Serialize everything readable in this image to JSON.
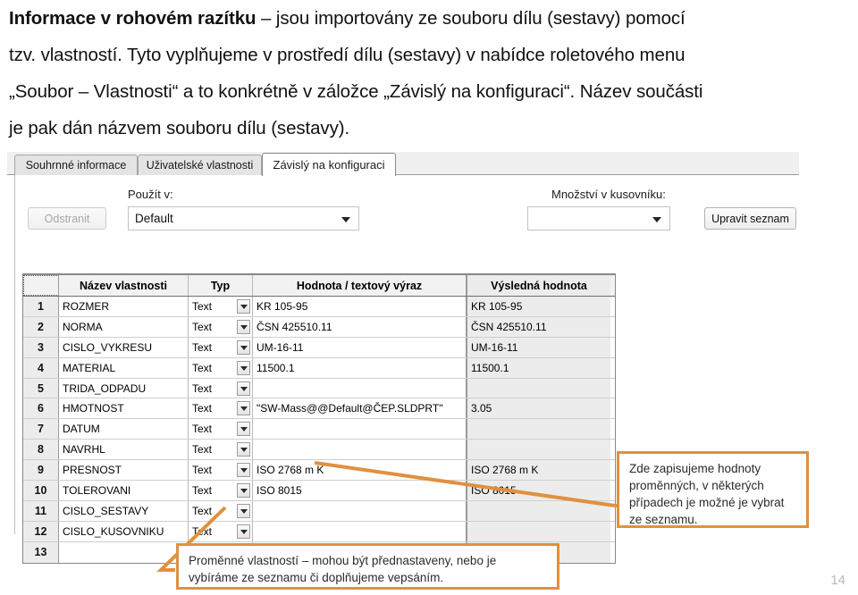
{
  "prose": {
    "lines": [
      {
        "bold": "Informace v rohovém razítku",
        "rest": " – jsou importovány ze souboru dílu (sestavy) pomocí"
      },
      {
        "bold": "",
        "rest": "tzv. vlastností. Tyto vyplňujeme v prostředí dílu (sestavy) v nabídce roletového menu"
      },
      {
        "bold": "",
        "rest": "„Soubor – Vlastnosti“ a to konkrétně v záložce „Závislý na konfiguraci“. Název součásti"
      },
      {
        "bold": "",
        "rest": "je pak dán názvem souboru dílu (sestavy)."
      }
    ]
  },
  "dialog": {
    "tabs": [
      {
        "label": "Souhrnné informace",
        "selected": false
      },
      {
        "label": "Uživatelské vlastnosti",
        "selected": false
      },
      {
        "label": "Závislý na konfiguraci",
        "selected": true
      }
    ],
    "labels": {
      "pouzit_v": "Použít v:",
      "mnozstvi": "Množství v kusovníku:"
    },
    "buttons": {
      "odstranit": "Odstranit",
      "upravit_seznam": "Upravit seznam"
    },
    "combos": {
      "pouzit_v_value": "Default",
      "pouzit_v_placeholder": "",
      "mnozstvi_value": "",
      "mnozstvi_placeholder": ""
    },
    "grid": {
      "headers": [
        "",
        "Název vlastnosti",
        "Typ",
        "Hodnota / textový výraz",
        "Výsledná hodnota"
      ],
      "rows": [
        {
          "idx": "1",
          "name": "ROZMER",
          "type": "Text",
          "value": "KR 105-95",
          "result": "KR 105-95"
        },
        {
          "idx": "2",
          "name": "NORMA",
          "type": "Text",
          "value": "ČSN 425510.11",
          "result": "ČSN 425510.11"
        },
        {
          "idx": "3",
          "name": "CISLO_VYKRESU",
          "type": "Text",
          "value": "UM-16-11",
          "result": "UM-16-11"
        },
        {
          "idx": "4",
          "name": "MATERIAL",
          "type": "Text",
          "value": "11500.1",
          "result": "11500.1"
        },
        {
          "idx": "5",
          "name": "TRIDA_ODPADU",
          "type": "Text",
          "value": "",
          "result": ""
        },
        {
          "idx": "6",
          "name": "HMOTNOST",
          "type": "Text",
          "value": "\"SW-Mass@@Default@ČEP.SLDPRT\"",
          "result": "3.05"
        },
        {
          "idx": "7",
          "name": "DATUM",
          "type": "Text",
          "value": "",
          "result": ""
        },
        {
          "idx": "8",
          "name": "NAVRHL",
          "type": "Text",
          "value": "",
          "result": ""
        },
        {
          "idx": "9",
          "name": "PRESNOST",
          "type": "Text",
          "value": "ISO 2768 m K",
          "result": "ISO 2768 m K"
        },
        {
          "idx": "10",
          "name": "TOLEROVANI",
          "type": "Text",
          "value": "ISO 8015",
          "result": "ISO 8015"
        },
        {
          "idx": "11",
          "name": "CISLO_SESTAVY",
          "type": "Text",
          "value": "",
          "result": ""
        },
        {
          "idx": "12",
          "name": "CISLO_KUSOVNIKU",
          "type": "Text",
          "value": "",
          "result": ""
        },
        {
          "idx": "13",
          "name": "",
          "type": "",
          "value": "",
          "result": ""
        }
      ]
    }
  },
  "annotations": {
    "right": "Zde zapisujeme hodnoty proměnných, v některých případech je možné je vybrat ze seznamu.",
    "bottom": "Proměnné vlastností – mohou být přednastaveny, nebo je vybíráme ze seznamu či doplňujeme vepsáním."
  },
  "footer": {
    "page_number": "14"
  },
  "colors": {
    "callout_border": "#e0913e",
    "leader": "#e0913e",
    "page_number": "#b8b8b8"
  }
}
